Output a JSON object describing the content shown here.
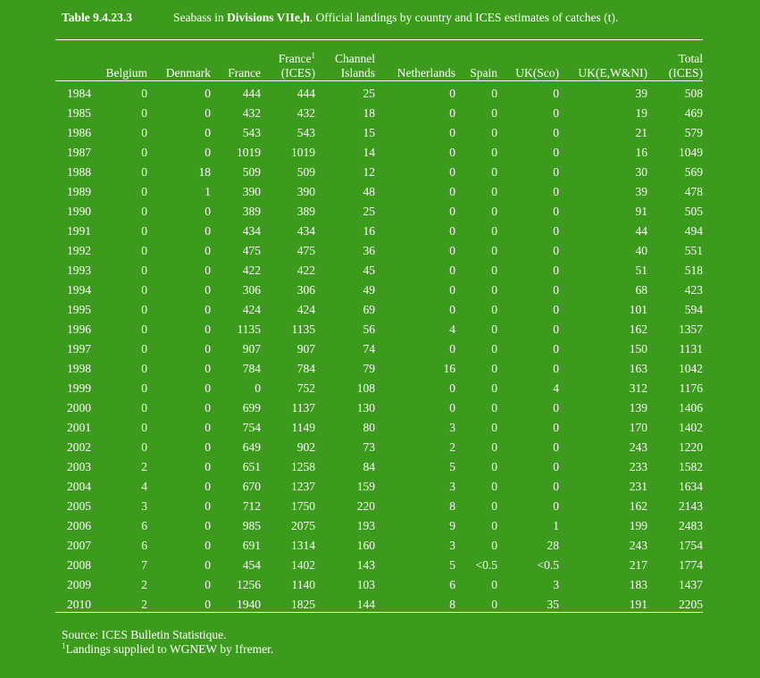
{
  "caption": {
    "label": "Table 9.4.23.3",
    "text_before": "Seabass in ",
    "text_bold": "Divisions VIIe,h",
    "text_after": ". Official landings by country and ICES estimates of catches (t)."
  },
  "columns": [
    {
      "line1": "",
      "line2": "",
      "sup": ""
    },
    {
      "line1": "",
      "line2": "Belgium",
      "sup": ""
    },
    {
      "line1": "",
      "line2": "Denmark",
      "sup": ""
    },
    {
      "line1": "",
      "line2": "France",
      "sup": ""
    },
    {
      "line1": "France",
      "line2": "(ICES)",
      "sup": "1"
    },
    {
      "line1": "Channel",
      "line2": "Islands",
      "sup": ""
    },
    {
      "line1": "",
      "line2": "Netherlands",
      "sup": ""
    },
    {
      "line1": "",
      "line2": "Spain",
      "sup": ""
    },
    {
      "line1": "",
      "line2": "UK(Sco)",
      "sup": ""
    },
    {
      "line1": "",
      "line2": "UK(E,W&NI)",
      "sup": ""
    },
    {
      "line1": "Total",
      "line2": "(ICES)",
      "sup": ""
    }
  ],
  "rows": [
    [
      "1984",
      "0",
      "0",
      "444",
      "444",
      "25",
      "0",
      "0",
      "0",
      "39",
      "508"
    ],
    [
      "1985",
      "0",
      "0",
      "432",
      "432",
      "18",
      "0",
      "0",
      "0",
      "19",
      "469"
    ],
    [
      "1986",
      "0",
      "0",
      "543",
      "543",
      "15",
      "0",
      "0",
      "0",
      "21",
      "579"
    ],
    [
      "1987",
      "0",
      "0",
      "1019",
      "1019",
      "14",
      "0",
      "0",
      "0",
      "16",
      "1049"
    ],
    [
      "1988",
      "0",
      "18",
      "509",
      "509",
      "12",
      "0",
      "0",
      "0",
      "30",
      "569"
    ],
    [
      "1989",
      "0",
      "1",
      "390",
      "390",
      "48",
      "0",
      "0",
      "0",
      "39",
      "478"
    ],
    [
      "1990",
      "0",
      "0",
      "389",
      "389",
      "25",
      "0",
      "0",
      "0",
      "91",
      "505"
    ],
    [
      "1991",
      "0",
      "0",
      "434",
      "434",
      "16",
      "0",
      "0",
      "0",
      "44",
      "494"
    ],
    [
      "1992",
      "0",
      "0",
      "475",
      "475",
      "36",
      "0",
      "0",
      "0",
      "40",
      "551"
    ],
    [
      "1993",
      "0",
      "0",
      "422",
      "422",
      "45",
      "0",
      "0",
      "0",
      "51",
      "518"
    ],
    [
      "1994",
      "0",
      "0",
      "306",
      "306",
      "49",
      "0",
      "0",
      "0",
      "68",
      "423"
    ],
    [
      "1995",
      "0",
      "0",
      "424",
      "424",
      "69",
      "0",
      "0",
      "0",
      "101",
      "594"
    ],
    [
      "1996",
      "0",
      "0",
      "1135",
      "1135",
      "56",
      "4",
      "0",
      "0",
      "162",
      "1357"
    ],
    [
      "1997",
      "0",
      "0",
      "907",
      "907",
      "74",
      "0",
      "0",
      "0",
      "150",
      "1131"
    ],
    [
      "1998",
      "0",
      "0",
      "784",
      "784",
      "79",
      "16",
      "0",
      "0",
      "163",
      "1042"
    ],
    [
      "1999",
      "0",
      "0",
      "0",
      "752",
      "108",
      "0",
      "0",
      "4",
      "312",
      "1176"
    ],
    [
      "2000",
      "0",
      "0",
      "699",
      "1137",
      "130",
      "0",
      "0",
      "0",
      "139",
      "1406"
    ],
    [
      "2001",
      "0",
      "0",
      "754",
      "1149",
      "80",
      "3",
      "0",
      "0",
      "170",
      "1402"
    ],
    [
      "2002",
      "0",
      "0",
      "649",
      "902",
      "73",
      "2",
      "0",
      "0",
      "243",
      "1220"
    ],
    [
      "2003",
      "2",
      "0",
      "651",
      "1258",
      "84",
      "5",
      "0",
      "0",
      "233",
      "1582"
    ],
    [
      "2004",
      "4",
      "0",
      "670",
      "1237",
      "159",
      "3",
      "0",
      "0",
      "231",
      "1634"
    ],
    [
      "2005",
      "3",
      "0",
      "712",
      "1750",
      "220",
      "8",
      "0",
      "0",
      "162",
      "2143"
    ],
    [
      "2006",
      "6",
      "0",
      "985",
      "2075",
      "193",
      "9",
      "0",
      "1",
      "199",
      "2483"
    ],
    [
      "2007",
      "6",
      "0",
      "691",
      "1314",
      "160",
      "3",
      "0",
      "28",
      "243",
      "1754"
    ],
    [
      "2008",
      "7",
      "0",
      "454",
      "1402",
      "143",
      "5",
      "<0.5",
      "<0.5",
      "217",
      "1774"
    ],
    [
      "2009",
      "2",
      "0",
      "1256",
      "1140",
      "103",
      "6",
      "0",
      "3",
      "183",
      "1437"
    ],
    [
      "2010",
      "2",
      "0",
      "1940",
      "1825",
      "144",
      "8",
      "0",
      "35",
      "191",
      "2205"
    ]
  ],
  "footnotes": {
    "source": "Source: ICES Bulletin Statistique.",
    "note_marker": "1",
    "note_text": "Landings supplied to WGNEW by Ifremer."
  },
  "colors": {
    "background": "#3c9a1c",
    "text": "#ffffff"
  }
}
